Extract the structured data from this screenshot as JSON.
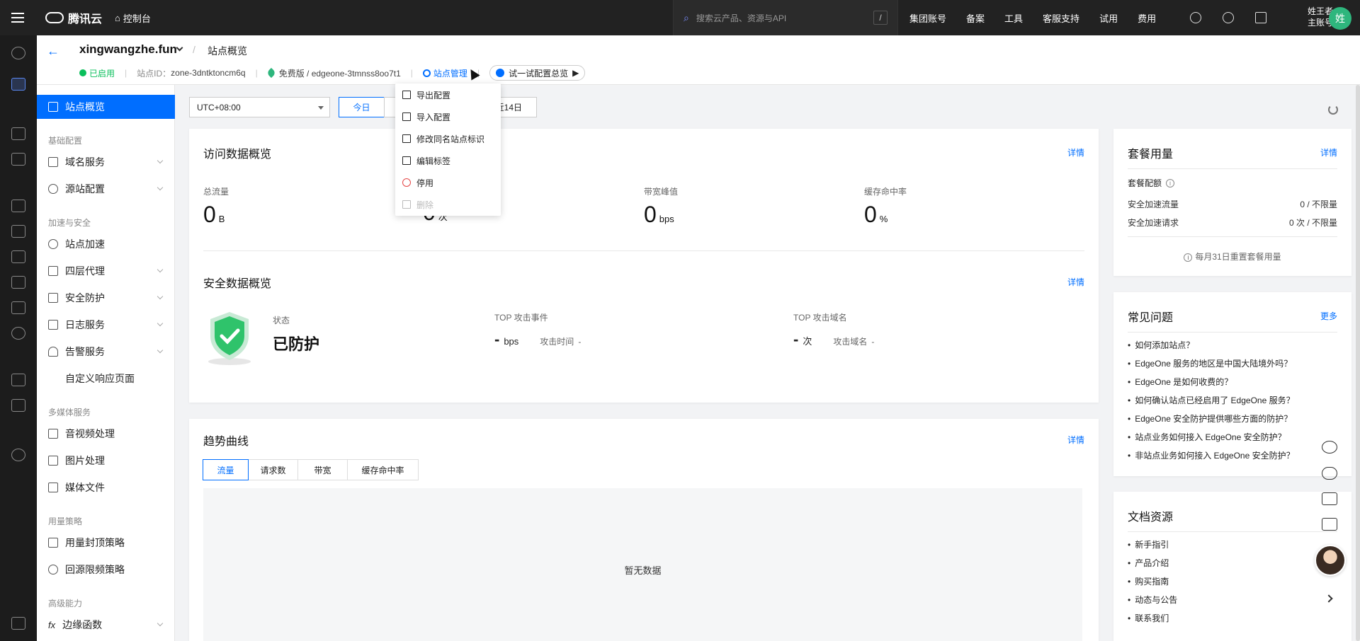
{
  "topbar": {
    "brand": "腾讯云",
    "console": "控制台",
    "search_placeholder": "搜索云产品、资源与API",
    "search_shortcut": "/",
    "nav": [
      "集团账号",
      "备案",
      "工具",
      "客服支持",
      "试用",
      "费用"
    ],
    "user_name": "姓王者",
    "user_role": "主账号",
    "avatar_text": "姓"
  },
  "header": {
    "domain": "xingwangzhe.fun",
    "breadcrumb": "站点概览",
    "status": "已启用",
    "site_id_label": "站点ID：",
    "site_id": "zone-3dntktoncm6q",
    "plan": "免费版 / edgeone-3tmnss8oo7t1",
    "manage": "站点管理",
    "try_config": "试一试配置总览"
  },
  "menu": {
    "overview": "站点概览",
    "group_basic": "基础配置",
    "domain_service": "域名服务",
    "origin_config": "源站配置",
    "group_accel": "加速与安全",
    "site_accel": "站点加速",
    "l4_proxy": "四层代理",
    "security": "安全防护",
    "log_service": "日志服务",
    "alarm_service": "告警服务",
    "custom_page": "自定义响应页面",
    "group_media": "多媒体服务",
    "av_process": "音视频处理",
    "image_process": "图片处理",
    "media_files": "媒体文件",
    "group_usage": "用量策略",
    "usage_cap": "用量封顶策略",
    "origin_limit": "回源限频策略",
    "group_advanced": "高级能力",
    "edge_functions": "边缘函数"
  },
  "toolbar": {
    "timezone": "UTC+08:00",
    "today": "今日",
    "last14": "近14日"
  },
  "context_menu": {
    "export": "导出配置",
    "import": "导入配置",
    "rename": "修改同名站点标识",
    "edit_tags": "编辑标签",
    "disable": "停用",
    "delete": "删除"
  },
  "access": {
    "title": "访问数据概览",
    "detail": "详情",
    "total_traffic_label": "总流量",
    "total_traffic_value": "0",
    "total_traffic_unit": "B",
    "requests_value": "0",
    "requests_unit": "次",
    "bandwidth_label": "带宽峰值",
    "bandwidth_value": "0",
    "bandwidth_unit": "bps",
    "cache_label": "缓存命中率",
    "cache_value": "0",
    "cache_unit": "%"
  },
  "security": {
    "title": "安全数据概览",
    "detail": "详情",
    "status_label": "状态",
    "status_value": "已防护",
    "top_event_label": "TOP 攻击事件",
    "top_event_value": "-",
    "top_event_unit": "bps",
    "attack_time_label": "攻击时间",
    "attack_time_value": "-",
    "top_domain_label": "TOP 攻击域名",
    "top_domain_value": "-",
    "top_domain_unit": "次",
    "attack_domain_label": "攻击域名",
    "attack_domain_value": "-"
  },
  "trend": {
    "title": "趋势曲线",
    "detail": "详情",
    "tabs": [
      "流量",
      "请求数",
      "带宽",
      "缓存命中率"
    ],
    "empty": "暂无数据"
  },
  "plan_usage": {
    "title": "套餐用量",
    "detail": "详情",
    "quota_label": "套餐配额",
    "rows": [
      {
        "label": "安全加速流量",
        "value": "0 / 不限量"
      },
      {
        "label": "安全加速请求",
        "value": "0 次 / 不限量"
      }
    ],
    "reset_note": "每月31日重置套餐用量"
  },
  "faq": {
    "title": "常见问题",
    "more": "更多",
    "items": [
      "如何添加站点？",
      "EdgeOne 服务的地区是中国大陆境外吗？",
      "EdgeOne 是如何收费的？",
      "如何确认站点已经启用了 EdgeOne 服务？",
      "EdgeOne 安全防护提供哪些方面的防护？",
      "站点业务如何接入 EdgeOne 安全防护？",
      "非站点业务如何接入 EdgeOne 安全防护？"
    ]
  },
  "docs": {
    "title": "文档资源",
    "items": [
      "新手指引",
      "产品介绍",
      "购买指南",
      "动态与公告",
      "联系我们"
    ]
  }
}
